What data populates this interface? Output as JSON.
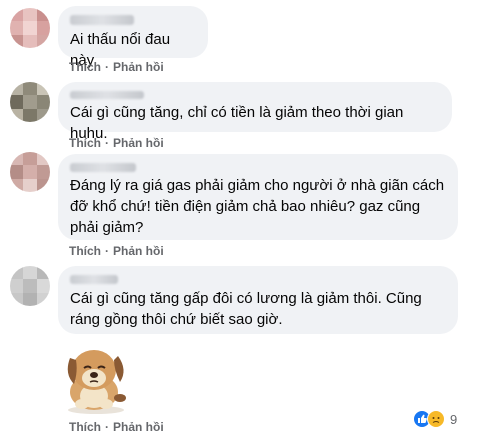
{
  "comments": [
    {
      "text": "Ai thấu nổi đau này",
      "actions": [
        "Thích",
        "Phản hồi"
      ]
    },
    {
      "text": "Cái gì cũng tăng, chỉ có tiền là giảm theo thời gian huhu.",
      "actions": [
        "Thích",
        "Phản hồi"
      ]
    },
    {
      "text": "Đáng lý ra giá gas phải giảm cho người ở nhà giãn cách đỡ khổ chứ! tiền điện giảm chả bao nhiêu? gaz cũng phải giảm?",
      "actions": [
        "Thích",
        "Phản hồi"
      ]
    },
    {
      "text": "Cái gì cũng tăng gấp đôi có lương là giảm thôi. Cũng ráng gồng thôi chứ biết sao giờ.",
      "actions": [
        "Thích",
        "Phản hồi"
      ],
      "sticker": "sad-dog-sticker",
      "reaction_count": "9",
      "reactions": [
        "like-icon",
        "sad-icon"
      ]
    }
  ],
  "colors": {
    "bubble": "#f0f2f5",
    "action": "#65676b",
    "like": "#1877f2"
  }
}
